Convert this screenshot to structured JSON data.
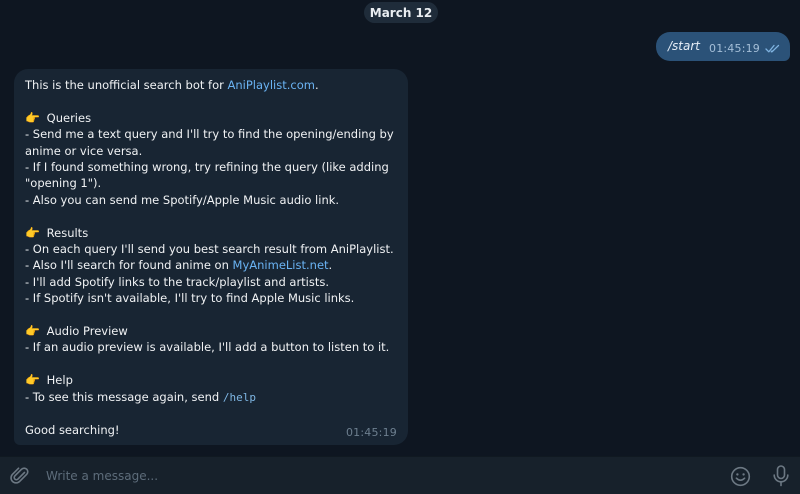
{
  "date_separator": "March 12",
  "outgoing": {
    "text": "/start",
    "time": "01:45:19",
    "status_icon": "double-check-icon"
  },
  "incoming": {
    "intro_prefix": "This is the unofficial search bot for ",
    "intro_link": "AniPlaylist.com",
    "intro_suffix": ".",
    "queries": {
      "emoji": "👉",
      "title": "Queries",
      "line1": "- Send me a text query and I'll try to find the opening/ending by",
      "line2": "anime or vice versa.",
      "line3": "- If I found something wrong, try refining the query (like adding",
      "line4": "\"opening 1\").",
      "line5": "- Also you can send me Spotify/Apple Music audio link."
    },
    "results": {
      "emoji": "👉",
      "title": "Results",
      "line1": "- On each query I'll send you best search result from AniPlaylist.",
      "line2_prefix": "- Also I'll search for found anime on ",
      "line2_link": "MyAnimeList.net",
      "line2_suffix": ".",
      "line3": "- I'll add Spotify links to the track/playlist and artists.",
      "line4": "- If Spotify isn't available, I'll try to find Apple Music links."
    },
    "audio_preview": {
      "emoji": "👉",
      "title": "Audio Preview",
      "line1": "- If an audio preview is available, I'll add a button to listen to it."
    },
    "help": {
      "emoji": "👉",
      "title": "Help",
      "line1_prefix": "- To see this message again, send ",
      "line1_command": "/help"
    },
    "closing": "Good searching!",
    "time": "01:45:19"
  },
  "composer": {
    "placeholder": "Write a message...",
    "attach_icon": "paperclip-icon",
    "emoji_icon": "smiley-icon",
    "mic_icon": "microphone-icon"
  },
  "colors": {
    "background": "#0e1621",
    "incoming_bubble": "#182533",
    "outgoing_bubble": "#2b5278",
    "link": "#6ab3f3",
    "composer": "#17212b"
  }
}
